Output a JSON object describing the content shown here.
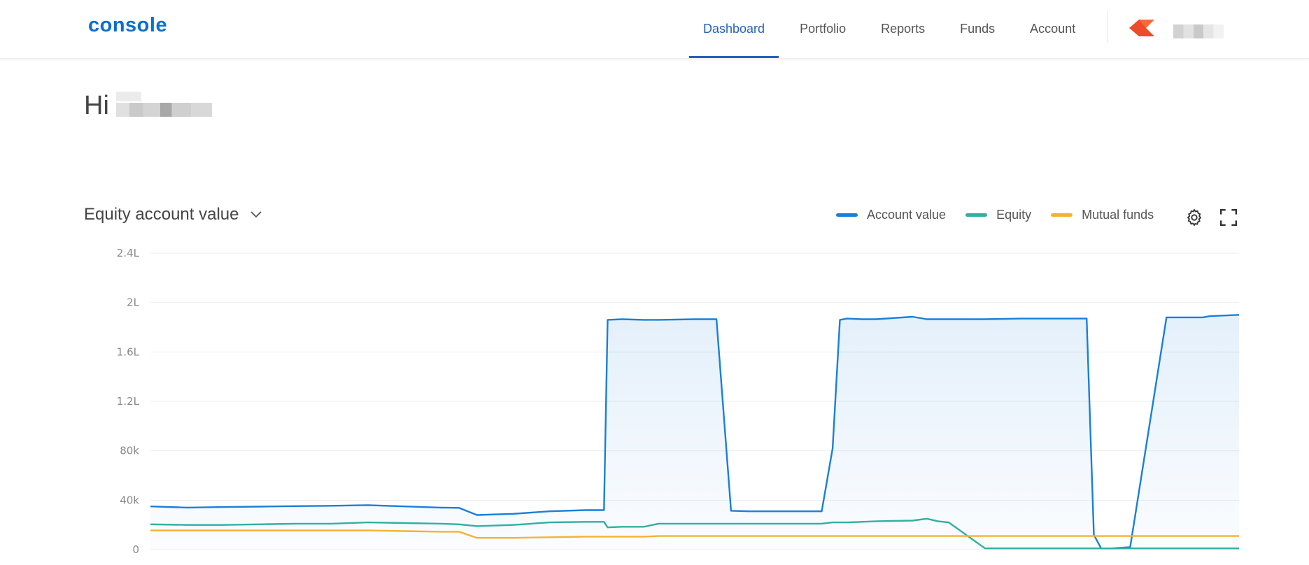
{
  "brand": {
    "name": "console",
    "color": "#0d6fce"
  },
  "nav": {
    "items": [
      {
        "label": "Dashboard",
        "active": true
      },
      {
        "label": "Portfolio",
        "active": false
      },
      {
        "label": "Reports",
        "active": false
      },
      {
        "label": "Funds",
        "active": false
      },
      {
        "label": "Account",
        "active": false
      }
    ]
  },
  "greeting": {
    "text": "Hi"
  },
  "chart_header": {
    "title": "Equity account value",
    "dropdown_icon": "chevron-down-icon"
  },
  "legend": {
    "items": [
      {
        "label": "Account value",
        "color": "#1a7fd8"
      },
      {
        "label": "Equity",
        "color": "#31afa4"
      },
      {
        "label": "Mutual funds",
        "color": "#f5b136"
      }
    ]
  },
  "toolbar": {
    "settings_icon": "gear-icon",
    "fullscreen_icon": "fullscreen-icon"
  },
  "chart_data": {
    "type": "area",
    "grid": true,
    "legend_position": "top-right",
    "ylim": [
      0,
      240000
    ],
    "yticks": [
      {
        "value": 0,
        "label": "0"
      },
      {
        "value": 40000,
        "label": "40k"
      },
      {
        "value": 80000,
        "label": "80k"
      },
      {
        "value": 120000,
        "label": "1.2L"
      },
      {
        "value": 160000,
        "label": "1.6L"
      },
      {
        "value": 200000,
        "label": "2L"
      },
      {
        "value": 240000,
        "label": "2.4L"
      }
    ],
    "x": [
      0,
      10,
      20,
      30,
      40,
      50,
      60,
      70,
      80,
      85,
      90,
      100,
      110,
      120,
      125,
      126,
      130,
      136,
      140,
      150,
      156,
      160,
      165,
      170,
      175,
      180,
      185,
      188,
      190,
      192,
      196,
      200,
      210,
      214,
      217,
      220,
      230,
      240,
      250,
      258,
      260,
      262,
      265,
      270,
      280,
      288,
      290,
      292,
      300
    ],
    "series": [
      {
        "name": "Account value",
        "color": "#1a7fd8",
        "fill": true,
        "values": [
          35000,
          34000,
          34500,
          34800,
          35200,
          35500,
          36000,
          35000,
          34000,
          33800,
          28000,
          29000,
          31000,
          32000,
          32000,
          186000,
          186500,
          186000,
          186000,
          186500,
          186500,
          31500,
          31000,
          31000,
          31000,
          31000,
          31000,
          82000,
          186000,
          187000,
          186500,
          186500,
          188500,
          186500,
          186500,
          186500,
          186500,
          187000,
          187000,
          187000,
          12000,
          1000,
          1000,
          2000,
          188000,
          188000,
          188000,
          189000,
          190000
        ]
      },
      {
        "name": "Equity",
        "color": "#31afa4",
        "fill": false,
        "values": [
          20500,
          20000,
          20000,
          20500,
          21000,
          21000,
          22000,
          21500,
          21000,
          20500,
          19000,
          20000,
          22000,
          22500,
          22500,
          18000,
          18500,
          18500,
          21000,
          21000,
          21000,
          21000,
          21000,
          21000,
          21000,
          21000,
          21000,
          22000,
          22000,
          22000,
          22500,
          23000,
          23500,
          25000,
          23000,
          22000,
          1000,
          1000,
          1000,
          1000,
          1000,
          1000,
          1000,
          1000,
          1000,
          1000,
          1000,
          1000,
          1000
        ]
      },
      {
        "name": "Mutual funds",
        "color": "#f5b136",
        "fill": false,
        "values": [
          15500,
          15500,
          15500,
          15500,
          15500,
          15500,
          15500,
          15000,
          14500,
          14500,
          9500,
          9500,
          10000,
          10500,
          10500,
          10500,
          10500,
          10500,
          11000,
          11000,
          11000,
          11000,
          11000,
          11000,
          11000,
          11000,
          11000,
          11000,
          11000,
          11000,
          11000,
          11000,
          11000,
          11000,
          11000,
          11000,
          11000,
          11000,
          11000,
          11000,
          11000,
          11000,
          11000,
          11000,
          11000,
          11000,
          11000,
          11000,
          11000
        ]
      }
    ]
  }
}
